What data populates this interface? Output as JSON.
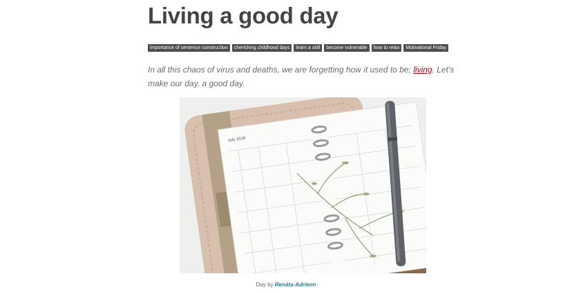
{
  "post": {
    "title": "Living a good day",
    "tags": [
      "Importance of sentence construction",
      "cherishing childhood days",
      "learn a skill",
      "become vulnerable",
      "how to relax",
      "Motivational Friday"
    ],
    "intro_before": "In all this chaos of virus and deaths, we are forgetting how it used to be; ",
    "intro_link": "living",
    "intro_after": ". Let's make our day, a good day.",
    "image": {
      "planner_month": "July 2018",
      "caption_prefix": "Day by ",
      "caption_author": "Renáta-Adrienn"
    }
  },
  "colors": {
    "tag_bg": "#4d4d4d",
    "link": "#b3001b",
    "caption_link": "#2a7c8a"
  }
}
